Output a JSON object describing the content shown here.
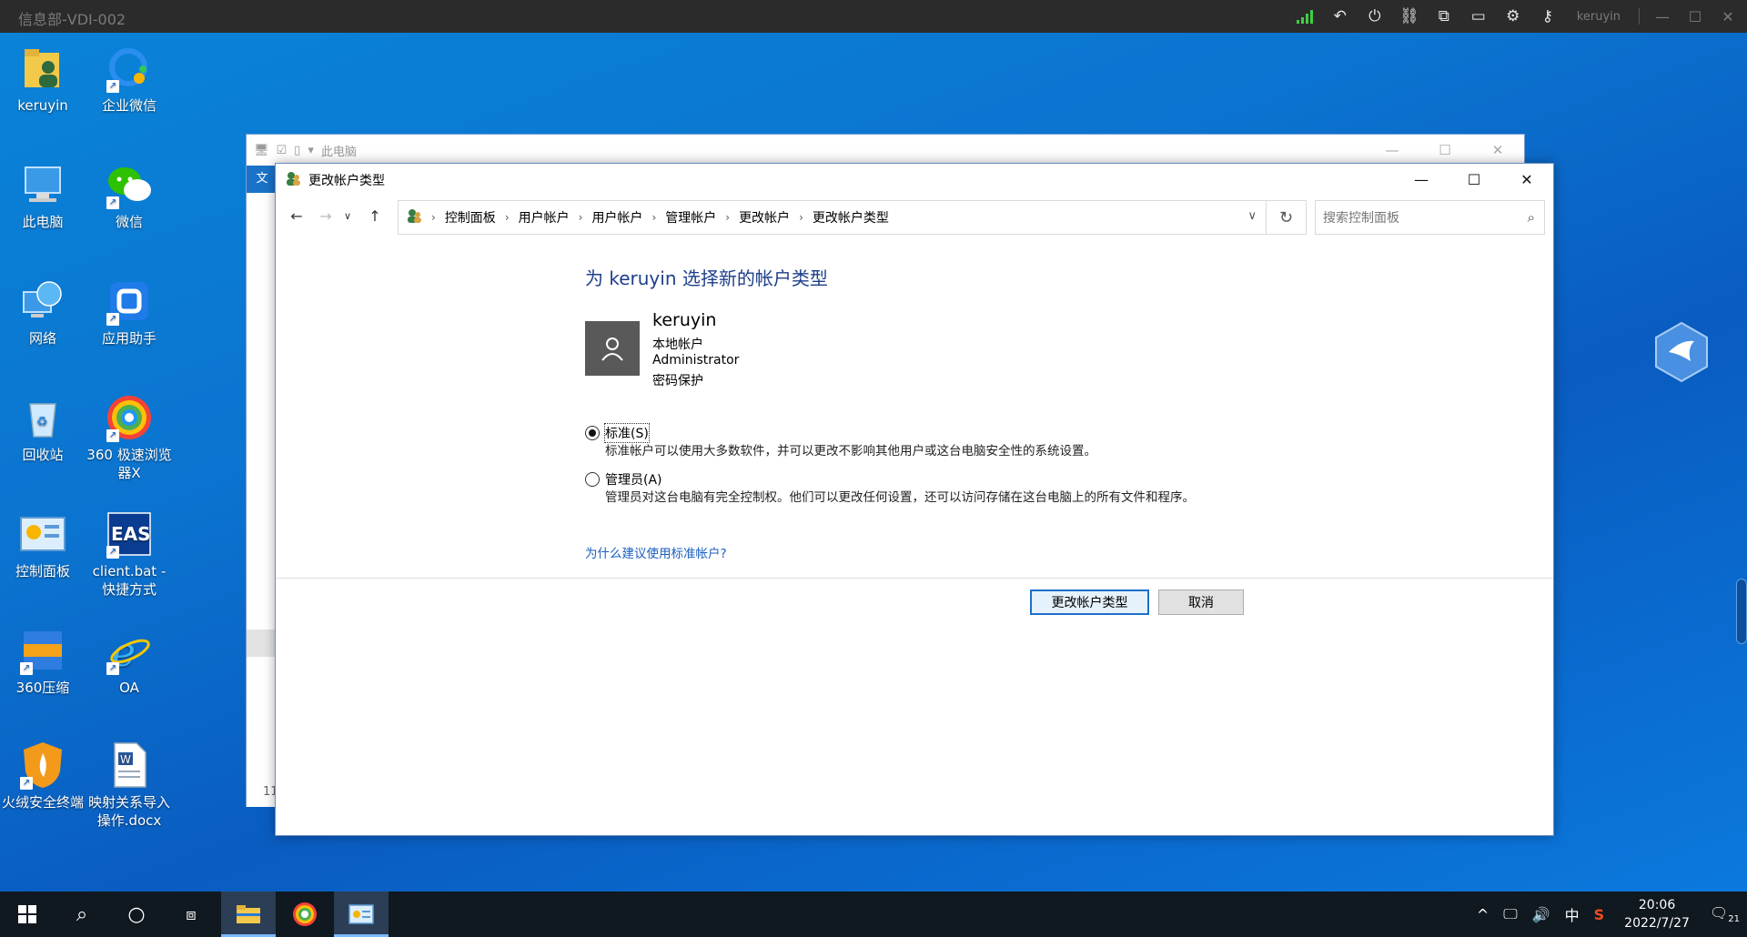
{
  "topbar": {
    "vdi_name": "信息部-VDI-002",
    "user": "keruyin",
    "icons": [
      "signal-icon",
      "back-icon",
      "power-icon",
      "unlink-icon",
      "switch-window-icon",
      "fullscreen-icon",
      "settings-icon",
      "user-key-icon"
    ]
  },
  "desktop": {
    "icons": [
      {
        "label": "keruyin"
      },
      {
        "label": "企业微信"
      },
      {
        "label": "此电脑"
      },
      {
        "label": "微信"
      },
      {
        "label": "网络"
      },
      {
        "label": "应用助手"
      },
      {
        "label": "回收站"
      },
      {
        "label": "360 极速浏览器X"
      },
      {
        "label": "控制面板"
      },
      {
        "label": "client.bat - 快捷方式"
      },
      {
        "label": "360压缩"
      },
      {
        "label": "OA"
      },
      {
        "label": "火绒安全终端"
      },
      {
        "label": "映射关系导入操作.docx"
      }
    ]
  },
  "explorer": {
    "title": "此电脑",
    "tab": "文",
    "count": "11"
  },
  "dialog": {
    "title": "更改帐户类型",
    "breadcrumb": [
      "控制面板",
      "用户帐户",
      "用户帐户",
      "管理帐户",
      "更改帐户",
      "更改帐户类型"
    ],
    "search_placeholder": "搜索控制面板",
    "heading": "为 keruyin 选择新的帐户类型",
    "user": {
      "name": "keruyin",
      "type": "本地帐户",
      "group": "Administrator",
      "protection": "密码保护"
    },
    "options": [
      {
        "label": "标准(S)",
        "desc": "标准帐户可以使用大多数软件，并可以更改不影响其他用户或这台电脑安全性的系统设置。",
        "selected": true
      },
      {
        "label": "管理员(A)",
        "desc": "管理员对这台电脑有完全控制权。他们可以更改任何设置，还可以访问存储在这台电脑上的所有文件和程序。",
        "selected": false
      }
    ],
    "why_link": "为什么建议使用标准帐户?",
    "buttons": {
      "confirm": "更改帐户类型",
      "cancel": "取消"
    }
  },
  "taskbar": {
    "ime": "中",
    "time": "20:06",
    "date": "2022/7/27",
    "notifications": "21"
  }
}
